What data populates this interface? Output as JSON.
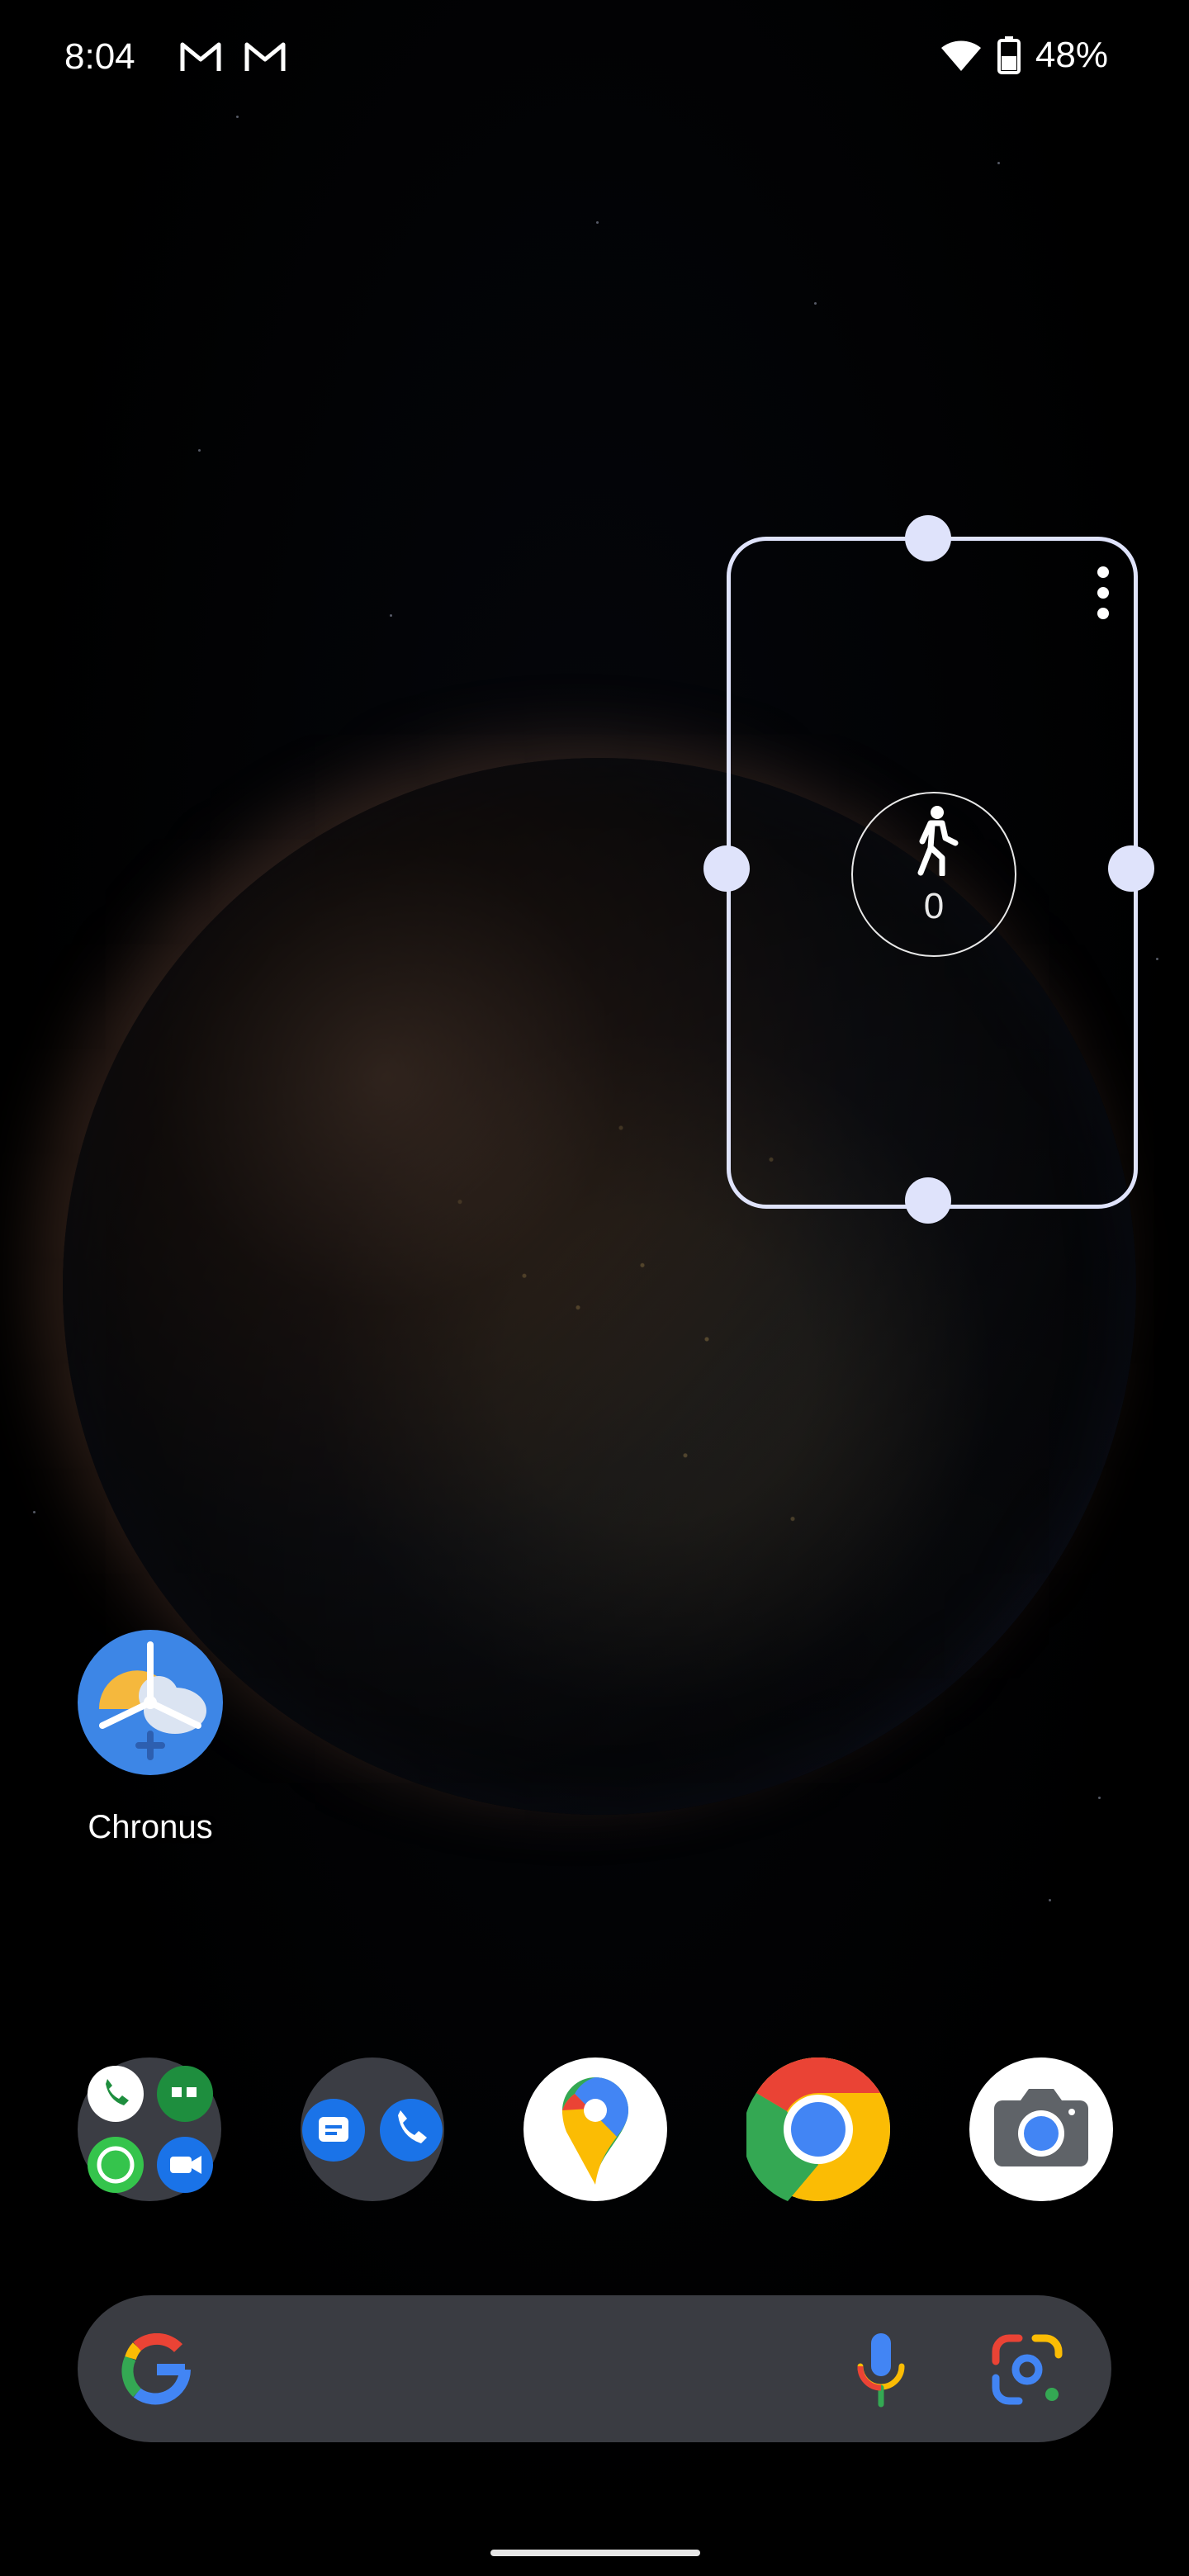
{
  "status_bar": {
    "time": "8:04",
    "notification_icons": [
      "gmail-icon",
      "gmail-icon"
    ],
    "wifi_icon": "wifi-icon",
    "battery_icon": "battery-icon",
    "battery_percent": "48%"
  },
  "widget": {
    "icon": "walking-person-icon",
    "step_count": "0",
    "menu_icon": "more-vertical-icon",
    "border_color": "#dfe3fb"
  },
  "home_apps": [
    {
      "label": "Chronus",
      "icon": "chronus-weather-icon"
    }
  ],
  "dock": [
    {
      "name": "communication-folder",
      "icons": [
        "phone-icon",
        "hangouts-icon",
        "whatsapp-icon",
        "duo-icon"
      ]
    },
    {
      "name": "messages-folder",
      "icons": [
        "messages-icon",
        "phone-icon"
      ]
    },
    {
      "name": "maps",
      "icon": "google-maps-icon"
    },
    {
      "name": "chrome",
      "icon": "chrome-icon"
    },
    {
      "name": "camera",
      "icon": "camera-icon"
    }
  ],
  "search_bar": {
    "logo": "google-g-icon",
    "mic_icon": "mic-icon",
    "lens_icon": "google-lens-icon",
    "background_color": "#3a3c42"
  }
}
